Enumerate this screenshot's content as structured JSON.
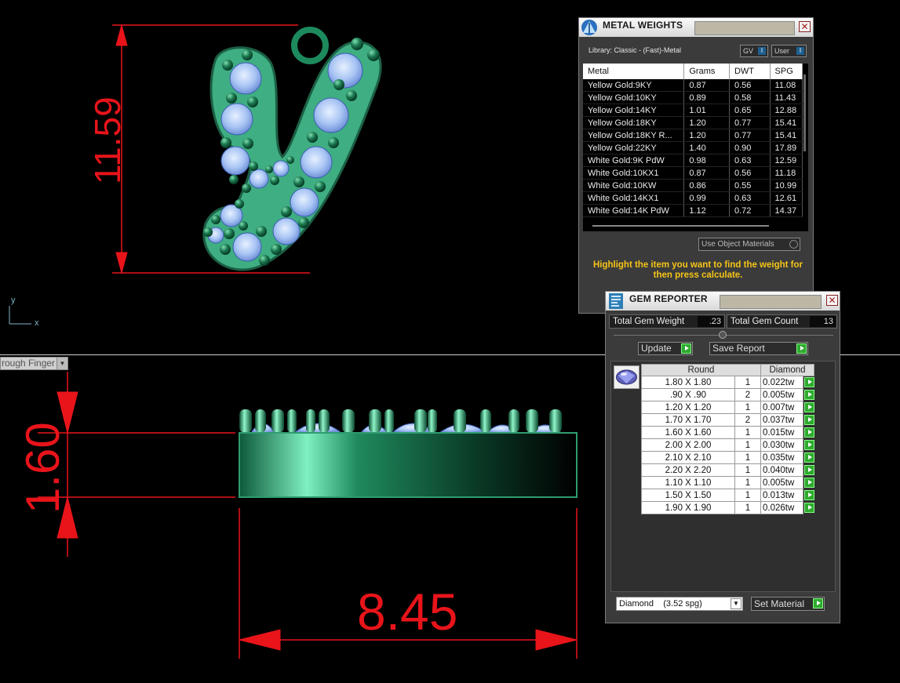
{
  "viewport": {
    "dim_top_height": "11.59",
    "dim_thickness": "1.60",
    "dim_width": "8.45",
    "axis_y": "y",
    "axis_x": "x",
    "view_mode": "rough Finger"
  },
  "metal_weights": {
    "title": "METAL WEIGHTS",
    "library": "Library: Classic - (Fast)-Metal",
    "toggle_gv": "GV",
    "toggle_user": "User",
    "columns": [
      "Metal",
      "Grams",
      "DWT",
      "SPG"
    ],
    "rows": [
      [
        "Yellow Gold:9KY",
        "0.87",
        "0.56",
        "11.08"
      ],
      [
        "Yellow Gold:10KY",
        "0.89",
        "0.58",
        "11.43"
      ],
      [
        "Yellow Gold:14KY",
        "1.01",
        "0.65",
        "12.88"
      ],
      [
        "Yellow Gold:18KY",
        "1.20",
        "0.77",
        "15.41"
      ],
      [
        "Yellow Gold:18KY R...",
        "1.20",
        "0.77",
        "15.41"
      ],
      [
        "Yellow Gold:22KY",
        "1.40",
        "0.90",
        "17.89"
      ],
      [
        "White Gold:9K PdW",
        "0.98",
        "0.63",
        "12.59"
      ],
      [
        "White Gold:10KX1",
        "0.87",
        "0.56",
        "11.18"
      ],
      [
        "White Gold:10KW",
        "0.86",
        "0.55",
        "10.99"
      ],
      [
        "White Gold:14KX1",
        "0.99",
        "0.63",
        "12.61"
      ],
      [
        "White Gold:14K PdW",
        "1.12",
        "0.72",
        "14.37"
      ]
    ],
    "use_object_materials": "Use Object Materials",
    "hint": "Highlight the item you want to find the weight for then press calculate."
  },
  "gem_reporter": {
    "title": "GEM REPORTER",
    "total_weight_label": "Total Gem Weight",
    "total_weight_value": ".23",
    "total_count_label": "Total Gem Count",
    "total_count_value": "13",
    "update_label": "Update",
    "save_report_label": "Save Report",
    "col_shape": "Round",
    "col_material": "Diamond",
    "rows": [
      [
        "1.80 X 1.80",
        "1",
        "0.022tw"
      ],
      [
        ".90 X .90",
        "2",
        "0.005tw"
      ],
      [
        "1.20 X 1.20",
        "1",
        "0.007tw"
      ],
      [
        "1.70 X 1.70",
        "2",
        "0.037tw"
      ],
      [
        "1.60 X 1.60",
        "1",
        "0.015tw"
      ],
      [
        "2.00 X 2.00",
        "1",
        "0.030tw"
      ],
      [
        "2.10 X 2.10",
        "1",
        "0.035tw"
      ],
      [
        "2.20 X 2.20",
        "1",
        "0.040tw"
      ],
      [
        "1.10 X 1.10",
        "1",
        "0.005tw"
      ],
      [
        "1.50 X 1.50",
        "1",
        "0.013tw"
      ],
      [
        "1.90 X 1.90",
        "1",
        "0.026tw"
      ]
    ],
    "material_select": "Diamond    (3.52 spg)",
    "set_material_label": "Set Material"
  }
}
